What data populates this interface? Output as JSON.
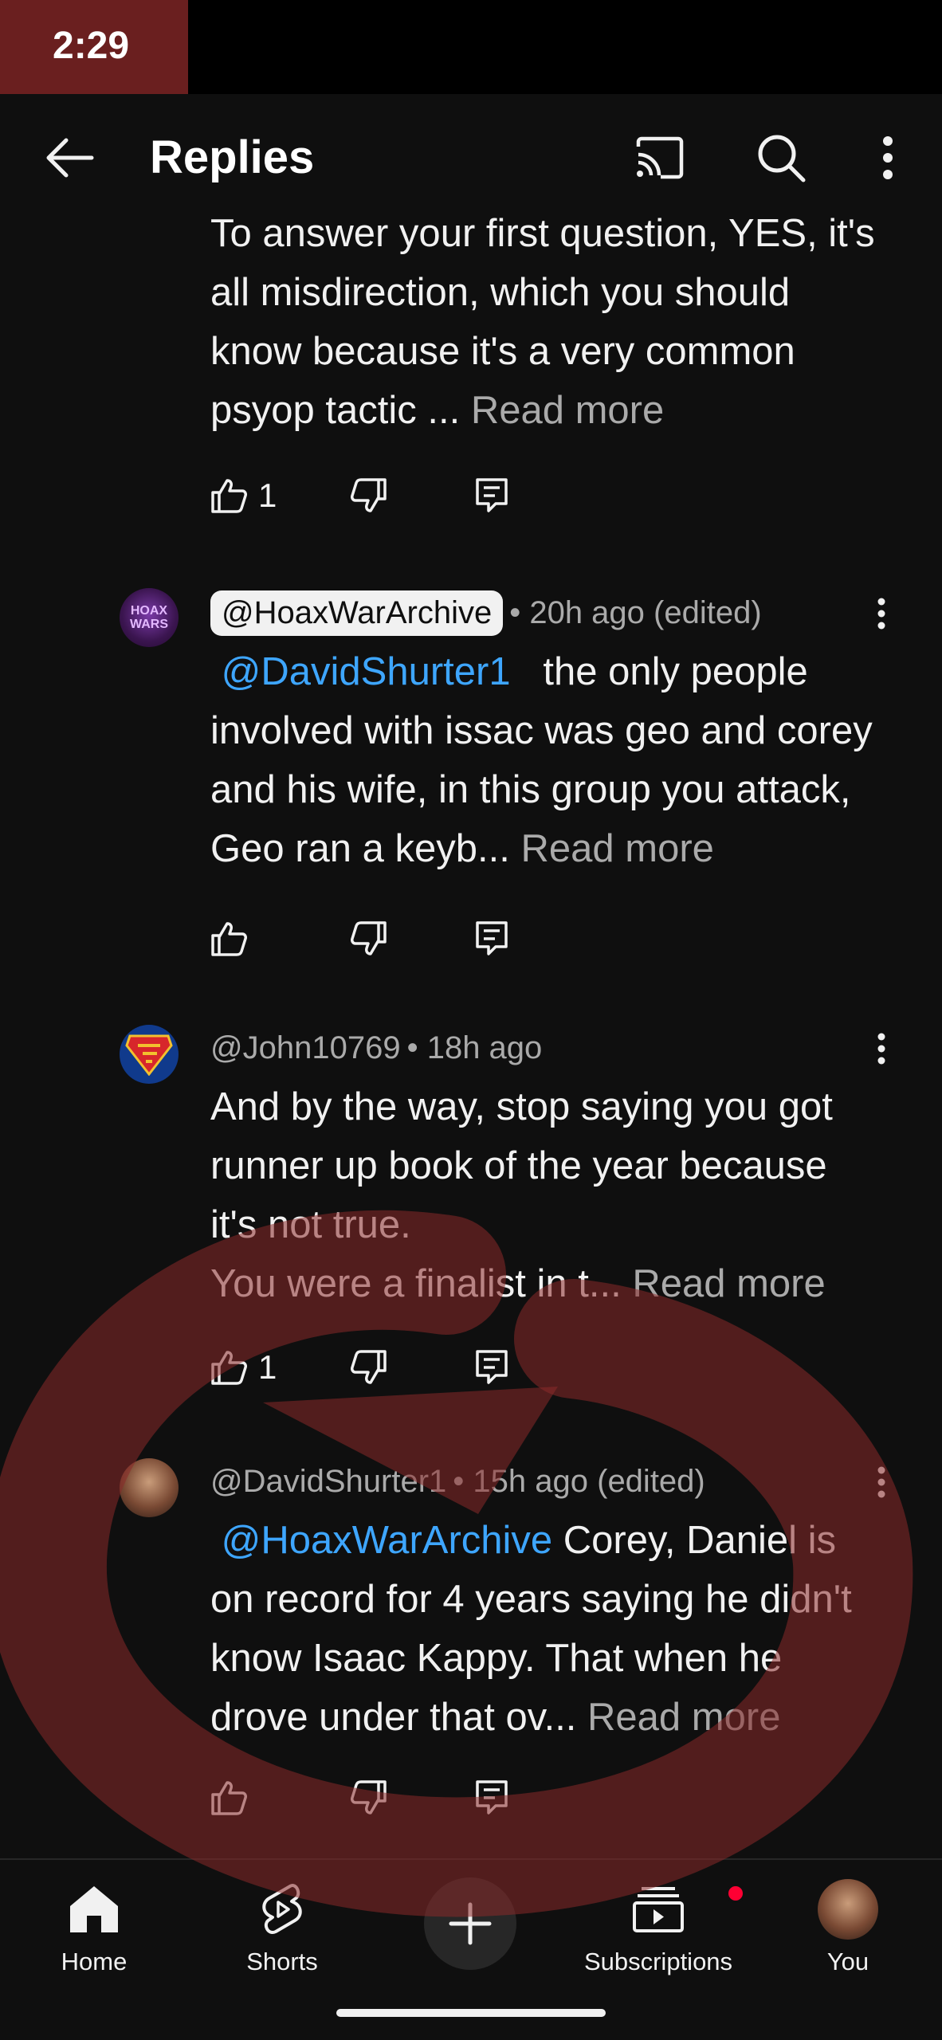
{
  "status_bar": {
    "time": "2:29"
  },
  "app_bar": {
    "title": "Replies",
    "icons": [
      "back-arrow-icon",
      "cast-icon",
      "search-icon",
      "more-vert-icon"
    ]
  },
  "comments": [
    {
      "continued": true,
      "body": "To answer your first question, YES, it's all misdirection, which you should know because it's a very common psyop tactic ... ",
      "read_more": "Read more",
      "likes": "1"
    },
    {
      "author": "@HoaxWarArchive",
      "author_highlighted": true,
      "meta": "• 20h ago (edited)",
      "mention": "@DavidShurter1",
      "body": "   the only people involved with issac was geo and corey and his wife, in this group you attack, Geo ran a keyb... ",
      "read_more": "Read more",
      "likes": "",
      "avatar_text": "HOAX WARS"
    },
    {
      "author": "@John10769",
      "meta": "• 18h ago",
      "mention": "",
      "body": "And by the way, stop saying you got runner up book of the year because it's not true.\nYou were a finalist in t... ",
      "read_more": "Read more",
      "likes": "1"
    },
    {
      "author": "@DavidShurter1",
      "meta": "• 15h ago (edited)",
      "mention": "@HoaxWarArchive",
      "body": " Corey, Daniel is on record for 4 years saying he didn't know Isaac Kappy. That when he drove under that ov... ",
      "read_more": "Read more",
      "likes": ""
    }
  ],
  "bottom_nav": {
    "home": "Home",
    "shorts": "Shorts",
    "subscriptions": "Subscriptions",
    "you": "You"
  },
  "colors": {
    "background": "#0f0f0f",
    "text": "#f1f1f1",
    "secondary_text": "#aaaaaa",
    "mention": "#3ea6ff",
    "notification": "#ff0033",
    "watermark": "#8b2a2a"
  }
}
